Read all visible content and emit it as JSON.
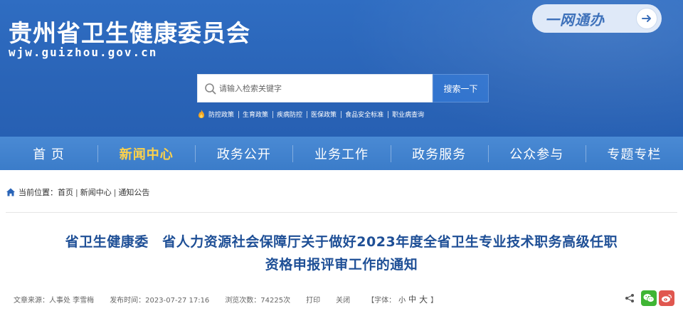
{
  "header": {
    "site_title": "贵州省卫生健康委员会",
    "site_domain": "wjw.guizhou.gov.cn",
    "one_net_label": "一网通办",
    "accent_color": "#2a64b7"
  },
  "search": {
    "placeholder": "请输入检索关键字",
    "button_label": "搜索一下",
    "hot_words": [
      "防控政策",
      "生育政策",
      "疾病防控",
      "医保政策",
      "食品安全标准",
      "职业病查询"
    ]
  },
  "nav": {
    "items": [
      "首 页",
      "新闻中心",
      "政务公开",
      "业务工作",
      "政务服务",
      "公众参与",
      "专题专栏"
    ],
    "active_index": 1,
    "active_color": "#ffd24a"
  },
  "breadcrumb": {
    "label": "当前位置：",
    "items": [
      "首页",
      "新闻中心",
      "通知公告"
    ],
    "separator": "|"
  },
  "article": {
    "title_line1": "省卫生健康委　省人力资源社会保障厅关于做好2023年度全省卫生专业技术职务高级任职",
    "title_line2": "资格申报评审工作的通知",
    "meta": {
      "source": "文章来源：人事处 李雪梅",
      "published": "发布时间：2023-07-27 17:16",
      "views": "浏览次数：74225次",
      "print": "打印",
      "close": "关闭",
      "font_label": "【字体：",
      "font_small": "小",
      "font_medium": "中",
      "font_large": "大",
      "font_close": "】"
    }
  },
  "icons": {
    "search": "search-icon",
    "fire": "fire-icon",
    "home": "home-icon",
    "share": "share-icon",
    "wechat": "wechat-icon",
    "weibo": "weibo-icon",
    "arrow": "arrow-right-icon"
  }
}
